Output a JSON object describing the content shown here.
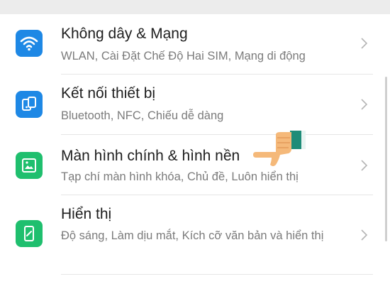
{
  "settings": {
    "items": [
      {
        "title": "Không dây & Mạng",
        "subtitle": "WLAN, Cài Đặt Chế Độ Hai SIM, Mạng di động",
        "icon": "wifi-icon",
        "color": "#1e88e5"
      },
      {
        "title": "Kết nối thiết bị",
        "subtitle": "Bluetooth, NFC, Chiếu dễ dàng",
        "icon": "device-connection-icon",
        "color": "#1e88e5"
      },
      {
        "title": "Màn hình chính & hình nền",
        "subtitle": "Tạp chí màn hình khóa, Chủ đề, Luôn hiển thị",
        "icon": "wallpaper-icon",
        "color": "#1fbf6e"
      },
      {
        "title": "Hiển thị",
        "subtitle": "Độ sáng, Làm dịu mắt, Kích cỡ văn bản và hiển thị",
        "icon": "display-icon",
        "color": "#1fbf6e"
      }
    ]
  },
  "overlay": {
    "icon": "pointing-hand-icon"
  }
}
